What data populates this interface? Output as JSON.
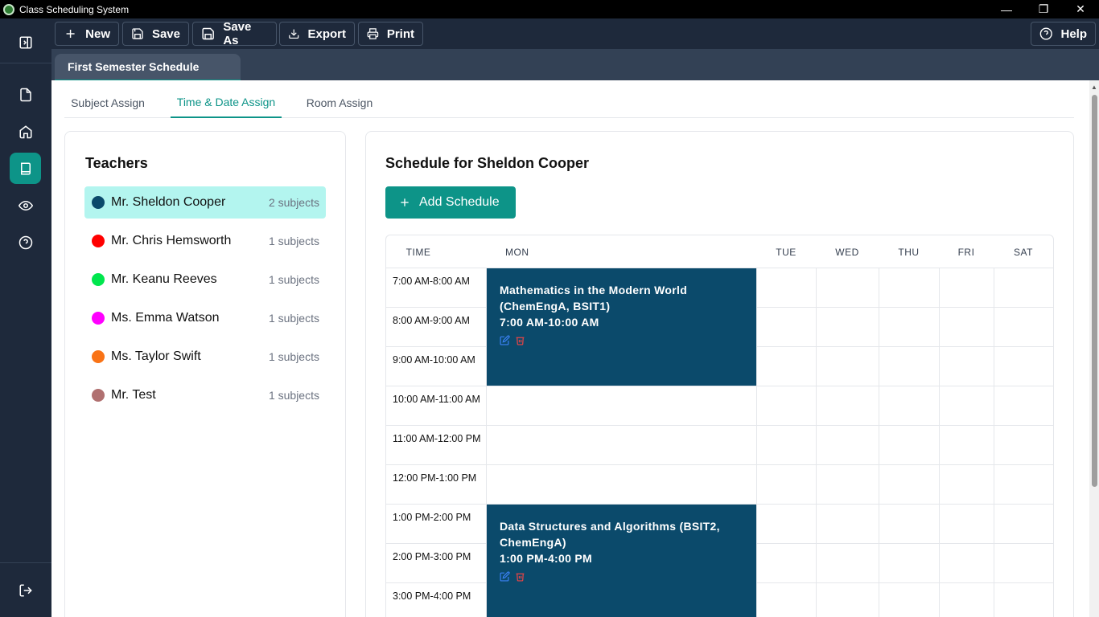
{
  "window": {
    "title": "Class Scheduling System",
    "controls": {
      "minimize": "—",
      "restore": "❐",
      "close": "✕"
    }
  },
  "toolbar": {
    "new_label": "New",
    "save_label": "Save",
    "save_as_label": "Save As",
    "export_label": "Export",
    "print_label": "Print",
    "help_label": "Help"
  },
  "document_tab": {
    "label": "First Semester Schedule"
  },
  "subtabs": [
    {
      "label": "Subject Assign"
    },
    {
      "label": "Time & Date Assign",
      "active": true
    },
    {
      "label": "Room Assign"
    }
  ],
  "teachers_panel": {
    "title": "Teachers",
    "items": [
      {
        "name": "Mr. Sheldon Cooper",
        "count": "2 subjects",
        "color": "#0b4a6b",
        "selected": true
      },
      {
        "name": "Mr. Chris Hemsworth",
        "count": "1 subjects",
        "color": "#ff0000"
      },
      {
        "name": "Mr. Keanu Reeves",
        "count": "1 subjects",
        "color": "#00e64d"
      },
      {
        "name": "Ms. Emma Watson",
        "count": "1 subjects",
        "color": "#ff00ff"
      },
      {
        "name": "Ms. Taylor Swift",
        "count": "1 subjects",
        "color": "#f97316"
      },
      {
        "name": "Mr. Test",
        "count": "1 subjects",
        "color": "#b07070"
      }
    ]
  },
  "schedule_panel": {
    "title": "Schedule for Sheldon Cooper",
    "add_button": "Add Schedule",
    "columns": [
      "TIME",
      "MON",
      "TUE",
      "WED",
      "THU",
      "FRI",
      "SAT"
    ],
    "time_slots": [
      "7:00 AM-8:00 AM",
      "8:00 AM-9:00 AM",
      "9:00 AM-10:00 AM",
      "10:00 AM-11:00 AM",
      "11:00 AM-12:00 PM",
      "12:00 PM-1:00 PM",
      "1:00 PM-2:00 PM",
      "2:00 PM-3:00 PM",
      "3:00 PM-4:00 PM"
    ],
    "events": [
      {
        "title": "Mathematics in the Modern World (ChemEngA, BSIT1)",
        "time": "7:00 AM-10:00 AM",
        "day": "MON",
        "color": "#0b4a6b"
      },
      {
        "title": "Data Structures and Algorithms (BSIT2, ChemEngA)",
        "time": "1:00 PM-4:00 PM",
        "day": "MON",
        "color": "#0b4a6b"
      }
    ]
  },
  "colors": {
    "accent": "#0d9488",
    "sidebar": "#1e293b",
    "tabstrip": "#334155",
    "selected_row": "#b3f5ef"
  },
  "icons": [
    "panel-toggle-icon",
    "document-icon",
    "home-icon",
    "book-icon",
    "eye-icon",
    "help-circle-icon",
    "logout-icon",
    "plus-icon",
    "save-icon",
    "save-as-icon",
    "download-icon",
    "printer-icon",
    "edit-icon",
    "trash-icon"
  ]
}
